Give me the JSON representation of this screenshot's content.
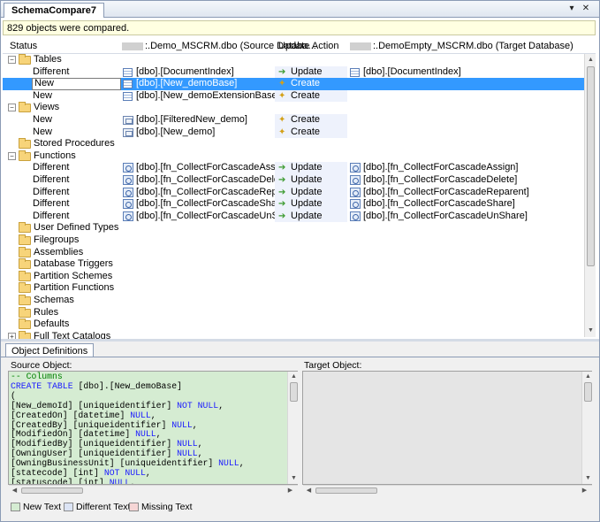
{
  "window": {
    "tab_title": "SchemaCompare7",
    "dropdown_glyph": "▾",
    "close_glyph": "✕"
  },
  "info_bar": {
    "text": "829 objects were compared."
  },
  "columns": {
    "status": "Status",
    "source": ":.Demo_MSCRM.dbo (Source Databa...",
    "action": "Update Action",
    "target": ":.DemoEmpty_MSCRM.dbo (Target Database)"
  },
  "rows": [
    {
      "kind": "group",
      "name": "Tables",
      "expanded": true
    },
    {
      "kind": "item",
      "status": "Different",
      "src": "[dbo].[DocumentIndex]",
      "action": "Update",
      "tgt": "[dbo].[DocumentIndex]",
      "icon": "table-icon"
    },
    {
      "kind": "item",
      "status": "New",
      "src": "[dbo].[New_demoBase]",
      "action": "Create",
      "tgt": "",
      "icon": "table-icon",
      "selected": true
    },
    {
      "kind": "item",
      "status": "New",
      "src": "[dbo].[New_demoExtensionBase]",
      "action": "Create",
      "tgt": "",
      "icon": "table-icon"
    },
    {
      "kind": "group",
      "name": "Views",
      "expanded": true
    },
    {
      "kind": "item",
      "status": "New",
      "src": "[dbo].[FilteredNew_demo]",
      "action": "Create",
      "tgt": "",
      "icon": "view-icon"
    },
    {
      "kind": "item",
      "status": "New",
      "src": "[dbo].[New_demo]",
      "action": "Create",
      "tgt": "",
      "icon": "view-icon"
    },
    {
      "kind": "group",
      "name": "Stored Procedures",
      "expanded": false,
      "leaf": true
    },
    {
      "kind": "group",
      "name": "Functions",
      "expanded": true
    },
    {
      "kind": "item",
      "status": "Different",
      "src": "[dbo].[fn_CollectForCascadeAssign]",
      "action": "Update",
      "tgt": "[dbo].[fn_CollectForCascadeAssign]",
      "icon": "function-icon"
    },
    {
      "kind": "item",
      "status": "Different",
      "src": "[dbo].[fn_CollectForCascadeDelete]",
      "action": "Update",
      "tgt": "[dbo].[fn_CollectForCascadeDelete]",
      "icon": "function-icon"
    },
    {
      "kind": "item",
      "status": "Different",
      "src": "[dbo].[fn_CollectForCascadeReparent]",
      "action": "Update",
      "tgt": "[dbo].[fn_CollectForCascadeReparent]",
      "icon": "function-icon"
    },
    {
      "kind": "item",
      "status": "Different",
      "src": "[dbo].[fn_CollectForCascadeShare]",
      "action": "Update",
      "tgt": "[dbo].[fn_CollectForCascadeShare]",
      "icon": "function-icon"
    },
    {
      "kind": "item",
      "status": "Different",
      "src": "[dbo].[fn_CollectForCascadeUnShare]",
      "action": "Update",
      "tgt": "[dbo].[fn_CollectForCascadeUnShare]",
      "icon": "function-icon"
    },
    {
      "kind": "group",
      "name": "User Defined Types",
      "leaf": true
    },
    {
      "kind": "group",
      "name": "Filegroups",
      "leaf": true
    },
    {
      "kind": "group",
      "name": "Assemblies",
      "leaf": true
    },
    {
      "kind": "group",
      "name": "Database Triggers",
      "leaf": true
    },
    {
      "kind": "group",
      "name": "Partition Schemes",
      "leaf": true
    },
    {
      "kind": "group",
      "name": "Partition Functions",
      "leaf": true
    },
    {
      "kind": "group",
      "name": "Schemas",
      "leaf": true
    },
    {
      "kind": "group",
      "name": "Rules",
      "leaf": true
    },
    {
      "kind": "group",
      "name": "Defaults",
      "leaf": true
    },
    {
      "kind": "group",
      "name": "Full Text Catalogs",
      "expanded": false
    }
  ],
  "definitions": {
    "tab_label": "Object Definitions",
    "source_label": "Source Object:",
    "target_label": "Target Object:",
    "source_lines": [
      {
        "t": "-- Columns",
        "c": "cm"
      },
      {
        "t": "CREATE TABLE [dbo].[New_demoBase]",
        "c": "kw-start"
      },
      {
        "t": "(",
        "c": ""
      },
      {
        "t": "[New_demoId] [uniqueidentifier] NOT NULL,",
        "c": ""
      },
      {
        "t": "[CreatedOn] [datetime] NULL,",
        "c": ""
      },
      {
        "t": "[CreatedBy] [uniqueidentifier] NULL,",
        "c": ""
      },
      {
        "t": "[ModifiedOn] [datetime] NULL,",
        "c": ""
      },
      {
        "t": "[ModifiedBy] [uniqueidentifier] NULL,",
        "c": ""
      },
      {
        "t": "[OwningUser] [uniqueidentifier] NULL,",
        "c": ""
      },
      {
        "t": "[OwningBusinessUnit] [uniqueidentifier] NULL,",
        "c": ""
      },
      {
        "t": "[statecode] [int] NOT NULL,",
        "c": ""
      },
      {
        "t": "[statuscode] [int] NULL,",
        "c": ""
      }
    ]
  },
  "legend": {
    "new_text": "New Text",
    "different_text": "Different Text",
    "missing_text": "Missing Text",
    "new_color": "#d5ecd2",
    "different_color": "#dce4f5",
    "missing_color": "#f6d6d6"
  }
}
